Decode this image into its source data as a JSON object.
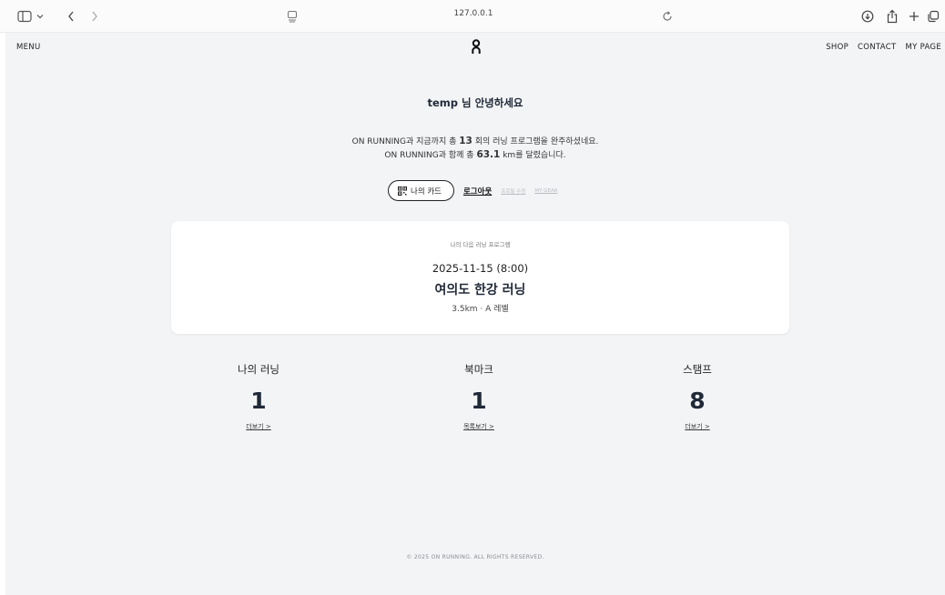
{
  "browser": {
    "url": "127.0.0.1"
  },
  "nav": {
    "menu": "MENU",
    "links": [
      "SHOP",
      "CONTACT",
      "MY PAGE"
    ]
  },
  "profile": {
    "greeting": "temp 님 안녕하세요",
    "stats_line1_prefix": "ON RUNNING과 지금까지 총 ",
    "stats_line1_value": "13",
    "stats_line1_suffix": " 회의 러닝 프로그램을 완주하셨네요.",
    "stats_line2_prefix": "ON RUNNING과 함께 총 ",
    "stats_line2_value": "63.1",
    "stats_line2_suffix": " km를 달렸습니다."
  },
  "actions": {
    "my_card": "나의 카드",
    "logout": "로그아웃",
    "edit_profile": "프로필 수정",
    "my_gear": "MY GEAR"
  },
  "next_program": {
    "label": "나의 다음 러닝 프로그램",
    "datetime": "2025-11-15 (8:00)",
    "title": "여의도 한강 러닝",
    "meta": "3.5km · A 레벨"
  },
  "summary": [
    {
      "title": "나의 러닝",
      "value": "1",
      "link": "더보기 >"
    },
    {
      "title": "북마크",
      "value": "1",
      "link": "목록보기 >"
    },
    {
      "title": "스탬프",
      "value": "8",
      "link": "더보기 >"
    }
  ],
  "footer": "© 2025 ON RUNNING. ALL RIGHTS RESERVED."
}
